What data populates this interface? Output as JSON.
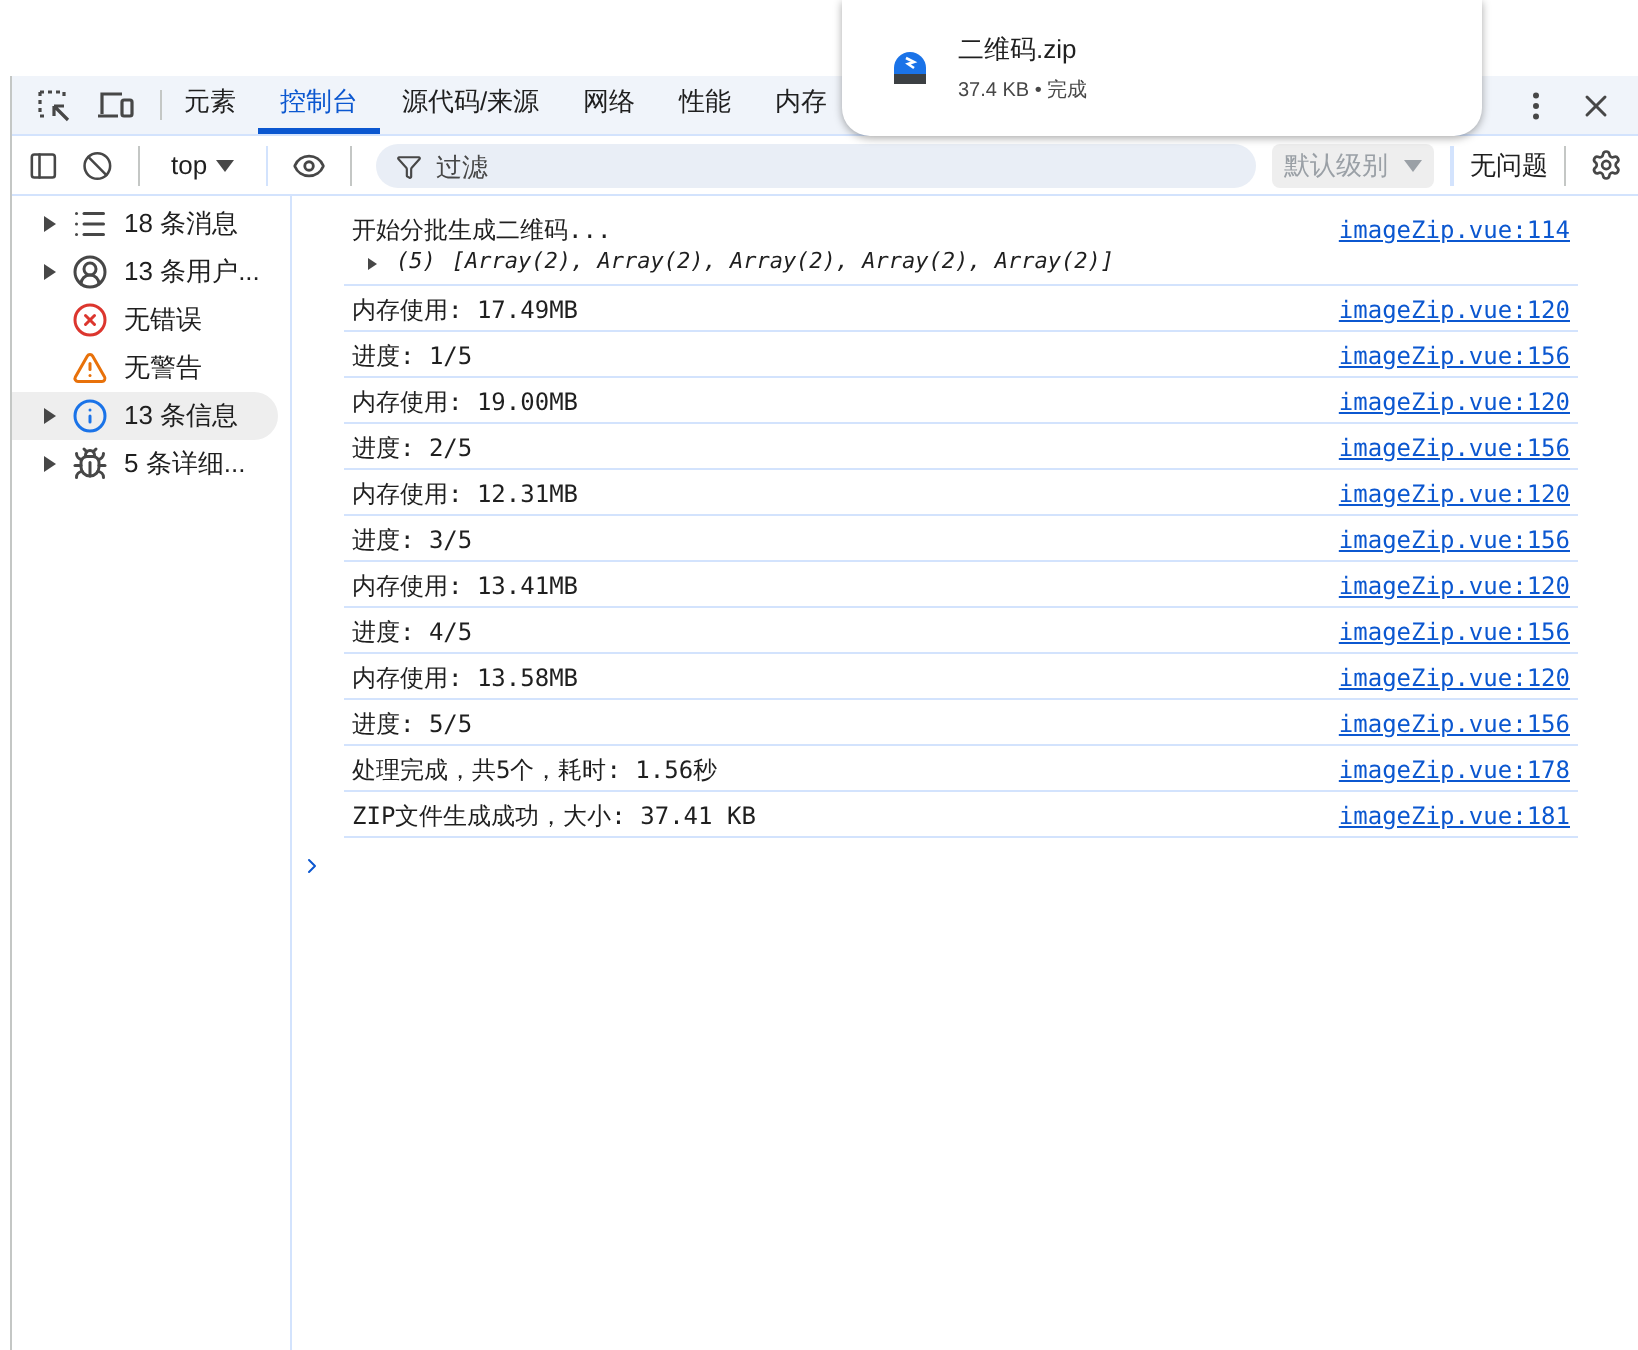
{
  "tabs": [
    {
      "label": "元素",
      "selected": false
    },
    {
      "label": "控制台",
      "selected": true
    },
    {
      "label": "源代码/来源",
      "selected": false
    },
    {
      "label": "网络",
      "selected": false
    },
    {
      "label": "性能",
      "selected": false
    },
    {
      "label": "内存",
      "selected": false
    }
  ],
  "toolbar": {
    "context": "top",
    "filter_placeholder": "过滤",
    "level": "默认级别",
    "issues": "无问题"
  },
  "sidebar": {
    "items": [
      {
        "kind": "messages",
        "label": "18 条消息",
        "expandable": true,
        "selected": false
      },
      {
        "kind": "user",
        "label": "13 条用户...",
        "expandable": true,
        "selected": false
      },
      {
        "kind": "error",
        "label": "无错误",
        "expandable": false,
        "selected": false
      },
      {
        "kind": "warning",
        "label": "无警告",
        "expandable": false,
        "selected": false
      },
      {
        "kind": "info",
        "label": "13 条信息",
        "expandable": true,
        "selected": true
      },
      {
        "kind": "verbose",
        "label": "5 条详细...",
        "expandable": true,
        "selected": false
      }
    ]
  },
  "console": {
    "messages": [
      {
        "text": "开始分批生成二维码...",
        "source": "imageZip.vue:114",
        "detail": {
          "count": "(5)",
          "text": "[Array(2), Array(2), Array(2), Array(2), Array(2)]",
          "expanded": false
        }
      },
      {
        "text": "内存使用: 17.49MB",
        "source": "imageZip.vue:120"
      },
      {
        "text": "进度: 1/5",
        "source": "imageZip.vue:156"
      },
      {
        "text": "内存使用: 19.00MB",
        "source": "imageZip.vue:120"
      },
      {
        "text": "进度: 2/5",
        "source": "imageZip.vue:156"
      },
      {
        "text": "内存使用: 12.31MB",
        "source": "imageZip.vue:120"
      },
      {
        "text": "进度: 3/5",
        "source": "imageZip.vue:156"
      },
      {
        "text": "内存使用: 13.41MB",
        "source": "imageZip.vue:120"
      },
      {
        "text": "进度: 4/5",
        "source": "imageZip.vue:156"
      },
      {
        "text": "内存使用: 13.58MB",
        "source": "imageZip.vue:120"
      },
      {
        "text": "进度: 5/5",
        "source": "imageZip.vue:156"
      },
      {
        "text": "处理完成，共5个，耗时: 1.56秒",
        "source": "imageZip.vue:178"
      },
      {
        "text": "ZIP文件生成成功，大小: 37.41 KB",
        "source": "imageZip.vue:181"
      }
    ]
  },
  "download": {
    "filename": "二维码.zip",
    "status": "37.4 KB • 完成"
  }
}
